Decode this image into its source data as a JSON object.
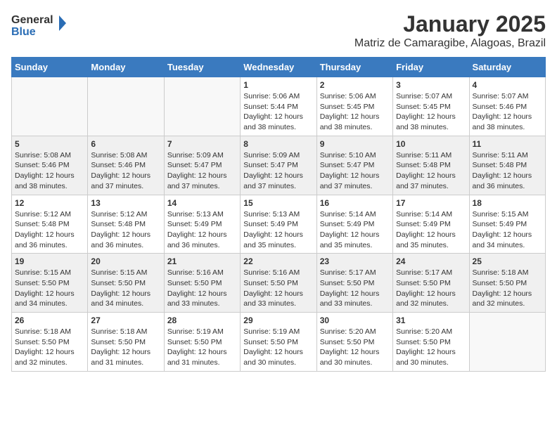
{
  "header": {
    "logo_line1": "General",
    "logo_line2": "Blue",
    "title": "January 2025",
    "subtitle": "Matriz de Camaragibe, Alagoas, Brazil"
  },
  "days_of_week": [
    "Sunday",
    "Monday",
    "Tuesday",
    "Wednesday",
    "Thursday",
    "Friday",
    "Saturday"
  ],
  "weeks": [
    [
      {
        "day": "",
        "content": ""
      },
      {
        "day": "",
        "content": ""
      },
      {
        "day": "",
        "content": ""
      },
      {
        "day": "1",
        "content": "Sunrise: 5:06 AM\nSunset: 5:44 PM\nDaylight: 12 hours\nand 38 minutes."
      },
      {
        "day": "2",
        "content": "Sunrise: 5:06 AM\nSunset: 5:45 PM\nDaylight: 12 hours\nand 38 minutes."
      },
      {
        "day": "3",
        "content": "Sunrise: 5:07 AM\nSunset: 5:45 PM\nDaylight: 12 hours\nand 38 minutes."
      },
      {
        "day": "4",
        "content": "Sunrise: 5:07 AM\nSunset: 5:46 PM\nDaylight: 12 hours\nand 38 minutes."
      }
    ],
    [
      {
        "day": "5",
        "content": "Sunrise: 5:08 AM\nSunset: 5:46 PM\nDaylight: 12 hours\nand 38 minutes."
      },
      {
        "day": "6",
        "content": "Sunrise: 5:08 AM\nSunset: 5:46 PM\nDaylight: 12 hours\nand 37 minutes."
      },
      {
        "day": "7",
        "content": "Sunrise: 5:09 AM\nSunset: 5:47 PM\nDaylight: 12 hours\nand 37 minutes."
      },
      {
        "day": "8",
        "content": "Sunrise: 5:09 AM\nSunset: 5:47 PM\nDaylight: 12 hours\nand 37 minutes."
      },
      {
        "day": "9",
        "content": "Sunrise: 5:10 AM\nSunset: 5:47 PM\nDaylight: 12 hours\nand 37 minutes."
      },
      {
        "day": "10",
        "content": "Sunrise: 5:11 AM\nSunset: 5:48 PM\nDaylight: 12 hours\nand 37 minutes."
      },
      {
        "day": "11",
        "content": "Sunrise: 5:11 AM\nSunset: 5:48 PM\nDaylight: 12 hours\nand 36 minutes."
      }
    ],
    [
      {
        "day": "12",
        "content": "Sunrise: 5:12 AM\nSunset: 5:48 PM\nDaylight: 12 hours\nand 36 minutes."
      },
      {
        "day": "13",
        "content": "Sunrise: 5:12 AM\nSunset: 5:48 PM\nDaylight: 12 hours\nand 36 minutes."
      },
      {
        "day": "14",
        "content": "Sunrise: 5:13 AM\nSunset: 5:49 PM\nDaylight: 12 hours\nand 36 minutes."
      },
      {
        "day": "15",
        "content": "Sunrise: 5:13 AM\nSunset: 5:49 PM\nDaylight: 12 hours\nand 35 minutes."
      },
      {
        "day": "16",
        "content": "Sunrise: 5:14 AM\nSunset: 5:49 PM\nDaylight: 12 hours\nand 35 minutes."
      },
      {
        "day": "17",
        "content": "Sunrise: 5:14 AM\nSunset: 5:49 PM\nDaylight: 12 hours\nand 35 minutes."
      },
      {
        "day": "18",
        "content": "Sunrise: 5:15 AM\nSunset: 5:49 PM\nDaylight: 12 hours\nand 34 minutes."
      }
    ],
    [
      {
        "day": "19",
        "content": "Sunrise: 5:15 AM\nSunset: 5:50 PM\nDaylight: 12 hours\nand 34 minutes."
      },
      {
        "day": "20",
        "content": "Sunrise: 5:15 AM\nSunset: 5:50 PM\nDaylight: 12 hours\nand 34 minutes."
      },
      {
        "day": "21",
        "content": "Sunrise: 5:16 AM\nSunset: 5:50 PM\nDaylight: 12 hours\nand 33 minutes."
      },
      {
        "day": "22",
        "content": "Sunrise: 5:16 AM\nSunset: 5:50 PM\nDaylight: 12 hours\nand 33 minutes."
      },
      {
        "day": "23",
        "content": "Sunrise: 5:17 AM\nSunset: 5:50 PM\nDaylight: 12 hours\nand 33 minutes."
      },
      {
        "day": "24",
        "content": "Sunrise: 5:17 AM\nSunset: 5:50 PM\nDaylight: 12 hours\nand 32 minutes."
      },
      {
        "day": "25",
        "content": "Sunrise: 5:18 AM\nSunset: 5:50 PM\nDaylight: 12 hours\nand 32 minutes."
      }
    ],
    [
      {
        "day": "26",
        "content": "Sunrise: 5:18 AM\nSunset: 5:50 PM\nDaylight: 12 hours\nand 32 minutes."
      },
      {
        "day": "27",
        "content": "Sunrise: 5:18 AM\nSunset: 5:50 PM\nDaylight: 12 hours\nand 31 minutes."
      },
      {
        "day": "28",
        "content": "Sunrise: 5:19 AM\nSunset: 5:50 PM\nDaylight: 12 hours\nand 31 minutes."
      },
      {
        "day": "29",
        "content": "Sunrise: 5:19 AM\nSunset: 5:50 PM\nDaylight: 12 hours\nand 30 minutes."
      },
      {
        "day": "30",
        "content": "Sunrise: 5:20 AM\nSunset: 5:50 PM\nDaylight: 12 hours\nand 30 minutes."
      },
      {
        "day": "31",
        "content": "Sunrise: 5:20 AM\nSunset: 5:50 PM\nDaylight: 12 hours\nand 30 minutes."
      },
      {
        "day": "",
        "content": ""
      }
    ]
  ]
}
